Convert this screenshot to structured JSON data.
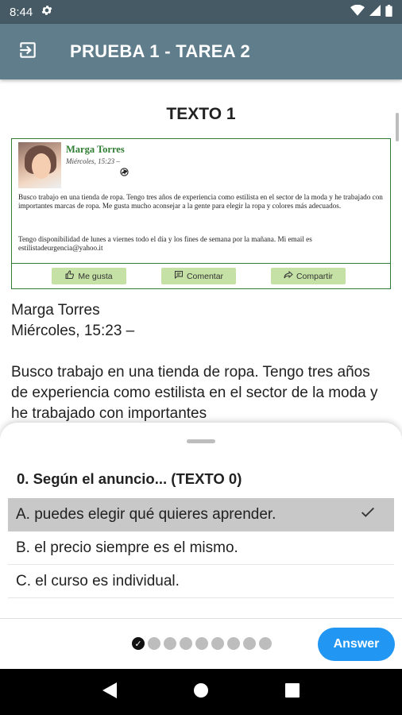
{
  "status_bar": {
    "time": "8:44"
  },
  "app_bar": {
    "title": "PRUEBA 1 - TAREA 2"
  },
  "content": {
    "heading": "TEXTO 1",
    "post": {
      "name": "Marga Torres",
      "date": "Miércoles, 15:23 –",
      "paragraph_1": "Busco trabajo en una tienda de ropa. Tengo tres años de experiencia como estilista en el sector de la moda y he trabajado con importantes marcas de ropa. Me gusta mucho aconsejar a la gente para elegir la ropa y colores más adecuados.",
      "paragraph_2": "Tengo disponibilidad de lunes a viernes todo el día y los fines de semana por la mañana. Mi email es estilistadeurgencia@yahoo.it",
      "like_label": "Me gusta",
      "comment_label": "Comentar",
      "share_label": "Compartir"
    },
    "author_name": "Marga Torres",
    "author_date": "Miércoles, 15:23 –",
    "body_text": "Busco trabajo en una tienda de ropa. Tengo tres años de experiencia como estilista en el sector de la moda y he trabajado con importantes"
  },
  "sheet": {
    "question": "0. Según el anuncio... (TEXTO 0)",
    "options": [
      {
        "label": "A. puedes elegir qué quieres aprender.",
        "selected": true
      },
      {
        "label": "B. el precio siempre es el mismo.",
        "selected": false
      },
      {
        "label": "C. el curso es individual.",
        "selected": false
      }
    ],
    "progress": {
      "completed": 1,
      "total": 9
    },
    "answer_label": "Answer"
  },
  "colors": {
    "status_bar": "#455a64",
    "app_bar": "#607d8b",
    "post_accent": "#2e7d32",
    "answer_button": "#2196f3",
    "selected_option": "#c8c8c8"
  }
}
